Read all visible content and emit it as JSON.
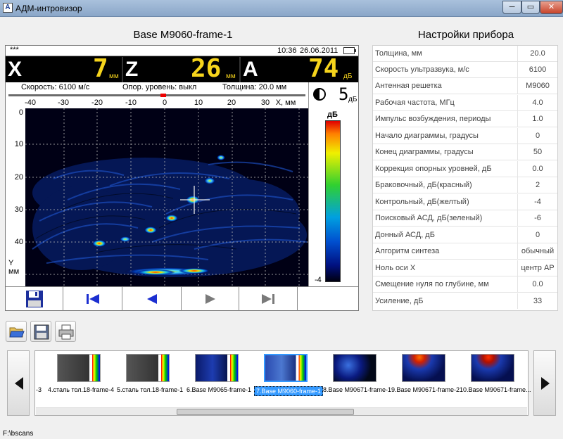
{
  "window": {
    "title": "АДМ-интровизор",
    "logo": "A",
    "minimize": "─",
    "maximize": "▭",
    "close": "✕"
  },
  "scan_title": "Base M9060-frame-1",
  "settings_title": "Настройки прибора",
  "device": {
    "stars": "***",
    "time": "10:36",
    "date": "26.06.2011",
    "readouts": [
      {
        "label": "X",
        "value": "7",
        "unit": "мм"
      },
      {
        "label": "Z",
        "value": "26",
        "unit": "мм"
      },
      {
        "label": "A",
        "value": "74",
        "unit": "дБ"
      }
    ],
    "speed": "Скорость:  6100 м/с",
    "reference": "Опор. уровень: выкл",
    "thickness": "Толщина:  20.0 мм",
    "gain_value": "5",
    "gain_unit": "дБ",
    "x_ticks": [
      "-40",
      "-30",
      "-20",
      "-10",
      "0",
      "10",
      "20",
      "30"
    ],
    "x_unit": "X, мм",
    "y_ticks": [
      "0",
      "10",
      "20",
      "30",
      "40"
    ],
    "y_unit": "Y\nмм",
    "palette_unit": "дБ",
    "palette_min": "-4"
  },
  "settings": [
    {
      "label": "Толщина, мм",
      "value": "20.0"
    },
    {
      "label": "Скорость ультразвука, м/с",
      "value": "6100"
    },
    {
      "label": "Антенная решетка",
      "value": "M9060"
    },
    {
      "label": "Рабочая частота, МГц",
      "value": "4.0"
    },
    {
      "label": "Импульс возбуждения, периоды",
      "value": "1.0"
    },
    {
      "label": "Начало диаграммы, градусы",
      "value": "0"
    },
    {
      "label": "Конец диаграммы, градусы",
      "value": "50"
    },
    {
      "label": "Коррекция опорных уровней, дБ",
      "value": "0.0"
    },
    {
      "label": "Браковочный, дБ(красный)",
      "value": "2"
    },
    {
      "label": "Контрольный, дБ(желтый)",
      "value": "-4"
    },
    {
      "label": "Поисковый АСД, дБ(зеленый)",
      "value": "-6"
    },
    {
      "label": "Донный АСД, дБ",
      "value": "0"
    },
    {
      "label": "Алгоритм синтеза",
      "value": "обычный"
    },
    {
      "label": "Ноль оси X",
      "value": "центр АР"
    },
    {
      "label": "Смещение нуля по глубине, мм",
      "value": "0.0"
    },
    {
      "label": "Усиление, дБ",
      "value": "33"
    }
  ],
  "thumbnails": [
    {
      "label": "-3",
      "selected": false
    },
    {
      "label": "4.сталь тол.18-frame-4",
      "selected": false
    },
    {
      "label": "5.сталь тол.18-frame-1",
      "selected": false
    },
    {
      "label": "6.Base M9065-frame-1",
      "selected": false
    },
    {
      "label": "7.Base M9060-frame-1",
      "selected": true
    },
    {
      "label": "8.Base M90671-frame-1",
      "selected": false
    },
    {
      "label": "9.Base M90671-frame-2",
      "selected": false
    },
    {
      "label": "10.Base M90671-frame...",
      "selected": false
    }
  ],
  "icons": [
    "open-folder-icon",
    "save-icon",
    "print-icon",
    "arrow-left-icon",
    "arrow-right-icon",
    "floppy-icon",
    "skip-first-icon",
    "prev-icon",
    "next-icon",
    "skip-last-icon",
    "contrast-icon"
  ],
  "status_path": "F:\\bscans"
}
